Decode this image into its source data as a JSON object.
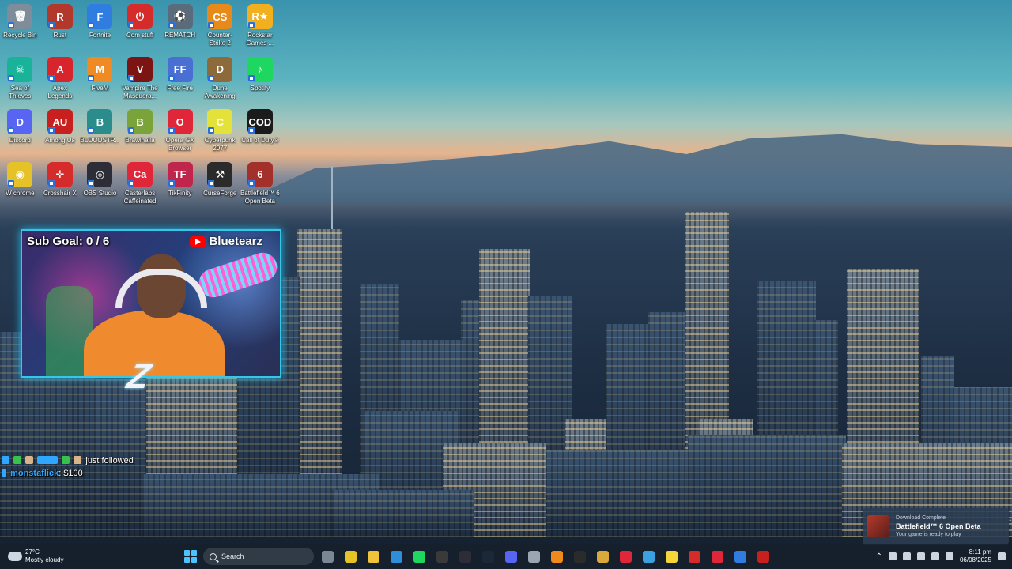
{
  "desktop_icons": [
    {
      "label": "Recycle Bin",
      "color": "#7f8c99",
      "glyph": "🗑"
    },
    {
      "label": "Rust",
      "color": "#b3382c",
      "glyph": "R"
    },
    {
      "label": "Fortnite",
      "color": "#2f7de1",
      "glyph": "F"
    },
    {
      "label": "Com stuff",
      "color": "#d62b2b",
      "glyph": "⏻"
    },
    {
      "label": "REMATCH",
      "color": "#5a6b7c",
      "glyph": "⚽"
    },
    {
      "label": "Counter-Strike 2",
      "color": "#e88a1a",
      "glyph": "CS"
    },
    {
      "label": "Rockstar Games ...",
      "color": "#f2b01e",
      "glyph": "R★"
    },
    {
      "label": "Sea of Thieves",
      "color": "#19b39a",
      "glyph": "☠"
    },
    {
      "label": "Apex Legends",
      "color": "#d8252b",
      "glyph": "A"
    },
    {
      "label": "FiveM",
      "color": "#f08a24",
      "glyph": "M"
    },
    {
      "label": "Vampire The Masquera...",
      "color": "#7d1414",
      "glyph": "V"
    },
    {
      "label": "Free Fire",
      "color": "#4a6fd3",
      "glyph": "FF"
    },
    {
      "label": "Dune Awakening",
      "color": "#8c6a3a",
      "glyph": "D"
    },
    {
      "label": "Spotify",
      "color": "#1ed760",
      "glyph": "♪"
    },
    {
      "label": "Discord",
      "color": "#5865f2",
      "glyph": "D"
    },
    {
      "label": "Among Us",
      "color": "#c8201f",
      "glyph": "AU"
    },
    {
      "label": "BLOODSTR...",
      "color": "#2b8c8c",
      "glyph": "B"
    },
    {
      "label": "Brawlhalla",
      "color": "#7aa33a",
      "glyph": "B"
    },
    {
      "label": "Opera GX Browser",
      "color": "#e0273a",
      "glyph": "O"
    },
    {
      "label": "Cyberpunk 2077",
      "color": "#e4e13a",
      "glyph": "C"
    },
    {
      "label": "Call of Duty®",
      "color": "#1b1b1b",
      "glyph": "COD"
    },
    {
      "label": "W chrome",
      "color": "#e6c229",
      "glyph": "◉"
    },
    {
      "label": "Crosshair X",
      "color": "#d62b2b",
      "glyph": "✛"
    },
    {
      "label": "OBS Studio",
      "color": "#2d2d38",
      "glyph": "◎"
    },
    {
      "label": "Casterlabs Caffeinated",
      "color": "#e0273a",
      "glyph": "Ca"
    },
    {
      "label": "TikFinity",
      "color": "#c0254b",
      "glyph": "TF"
    },
    {
      "label": "CurseForge",
      "color": "#2b2b2b",
      "glyph": "⚒"
    },
    {
      "label": "Battlefield™ 6 Open Beta",
      "color": "#a3302a",
      "glyph": "6"
    }
  ],
  "webcam": {
    "sub_goal": "Sub Goal: 0 / 6",
    "channel_name": "Bluetearz"
  },
  "chat": {
    "line1_text": "just followed",
    "line2_user": "monstaflick",
    "line2_amount": ": $100"
  },
  "toast": {
    "header": "Download Complete",
    "title": "Battlefield™ 6 Open Beta",
    "subtitle": "Your game is ready to play"
  },
  "taskbar": {
    "weather_temp": "27°C",
    "weather_desc": "Mostly cloudy",
    "search_label": "Search",
    "time": "8:11 pm",
    "date": "06/08/2025",
    "apps": [
      {
        "name": "taskbar-app-explorer-view",
        "color": "#7a8896"
      },
      {
        "name": "taskbar-app-chrome",
        "color": "#e6c229"
      },
      {
        "name": "taskbar-app-file-explorer",
        "color": "#f0c33c"
      },
      {
        "name": "taskbar-app-vscode",
        "color": "#2f8ed8"
      },
      {
        "name": "taskbar-app-spotify",
        "color": "#1ed760"
      },
      {
        "name": "taskbar-app-epic",
        "color": "#3a3a3a"
      },
      {
        "name": "taskbar-app-obs",
        "color": "#2d2d38"
      },
      {
        "name": "taskbar-app-steam",
        "color": "#1b2838"
      },
      {
        "name": "taskbar-app-discord",
        "color": "#5865f2"
      },
      {
        "name": "taskbar-app-tool",
        "color": "#9aa6b3"
      },
      {
        "name": "taskbar-app-vlc",
        "color": "#f08a1a"
      },
      {
        "name": "taskbar-app-curseforge",
        "color": "#2b2b2b"
      },
      {
        "name": "taskbar-app-gold",
        "color": "#d9a93a"
      },
      {
        "name": "taskbar-app-opera-gx",
        "color": "#e0273a"
      },
      {
        "name": "taskbar-app-photos",
        "color": "#3aa0e0"
      },
      {
        "name": "taskbar-app-sticky-notes",
        "color": "#f5d63a"
      },
      {
        "name": "taskbar-app-opera",
        "color": "#d62b2b"
      },
      {
        "name": "taskbar-app-casterlabs",
        "color": "#e0273a"
      },
      {
        "name": "taskbar-app-fortnite",
        "color": "#2f7de1"
      },
      {
        "name": "taskbar-app-red",
        "color": "#c8201f"
      }
    ]
  }
}
